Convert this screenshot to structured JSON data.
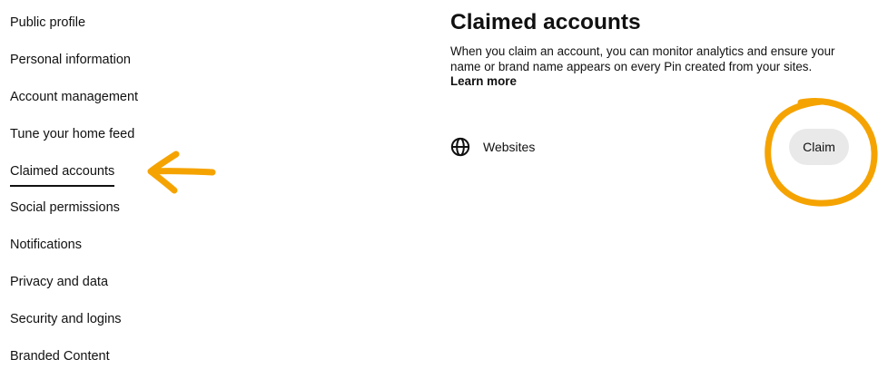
{
  "sidebar": {
    "items": [
      {
        "label": "Public profile",
        "active": false
      },
      {
        "label": "Personal information",
        "active": false
      },
      {
        "label": "Account management",
        "active": false
      },
      {
        "label": "Tune your home feed",
        "active": false
      },
      {
        "label": "Claimed accounts",
        "active": true
      },
      {
        "label": "Social permissions",
        "active": false
      },
      {
        "label": "Notifications",
        "active": false
      },
      {
        "label": "Privacy and data",
        "active": false
      },
      {
        "label": "Security and logins",
        "active": false
      },
      {
        "label": "Branded Content",
        "active": false
      }
    ]
  },
  "main": {
    "title": "Claimed accounts",
    "description": "When you claim an account, you can monitor analytics and ensure your name or brand name appears on every Pin created from your sites.",
    "learn_more": "Learn more",
    "claim_row": {
      "icon": "globe-icon",
      "label": "Websites",
      "button_label": "Claim"
    }
  },
  "annotations": {
    "color": "#f5a300",
    "marks": [
      "arrow pointing at Claimed accounts",
      "circle around Claim button"
    ]
  }
}
